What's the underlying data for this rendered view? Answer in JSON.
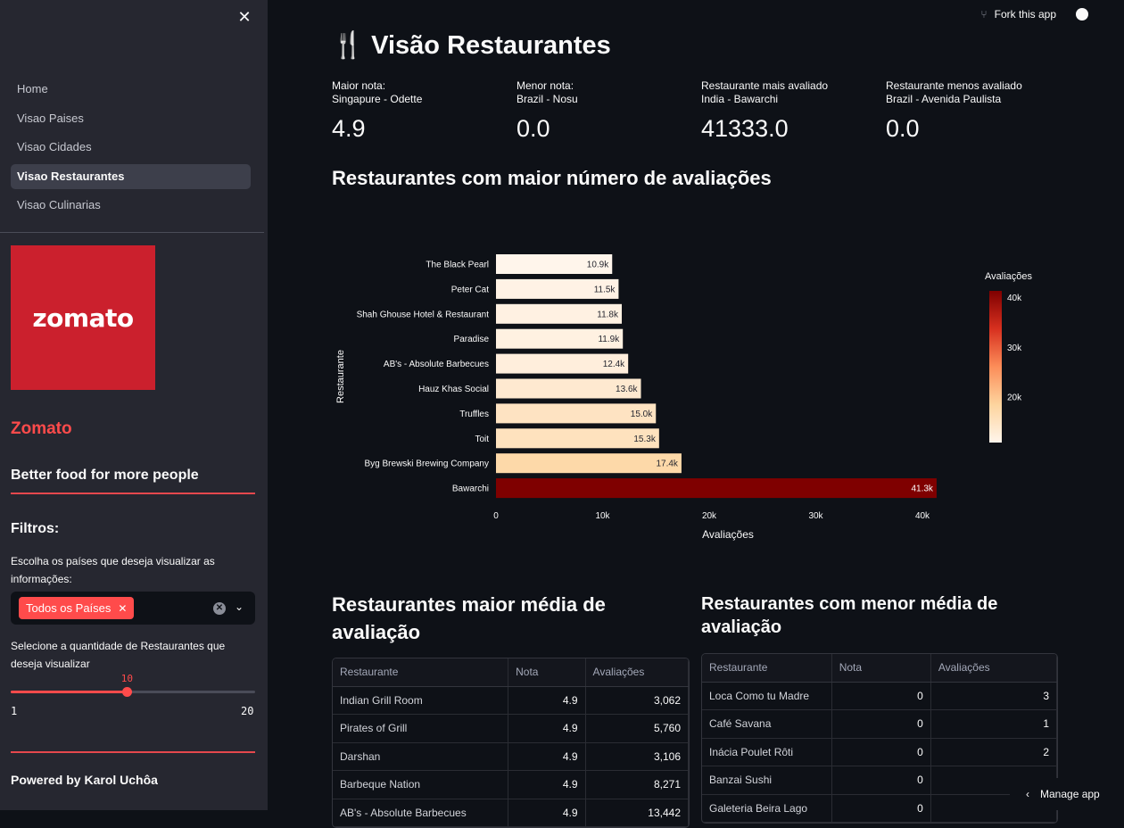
{
  "sidebar": {
    "nav": [
      "Home",
      "Visao Paises",
      "Visao Cidades",
      "Visao Restaurantes",
      "Visao Culinarias"
    ],
    "logo_text": "zomato",
    "brand": "Zomato",
    "tagline": "Better food for more people",
    "filters_title": "Filtros:",
    "countries_label": "Escolha os países que deseja visualizar as informações:",
    "countries_selected": "Todos os Países",
    "qty_label": "Selecione a quantidade de Restaurantes que deseja visualizar",
    "slider": {
      "value": 10,
      "min": 1,
      "max": 20
    },
    "powered_by": "Powered by Karol Uchôa"
  },
  "topbar": {
    "fork_label": "Fork this app"
  },
  "page": {
    "title": "🍴 Visão Restaurantes"
  },
  "metrics": [
    {
      "label1": "Maior nota:",
      "label2": "Singapure - Odette",
      "value": "4.9"
    },
    {
      "label1": "Menor nota:",
      "label2": "Brazil - Nosu",
      "value": "0.0"
    },
    {
      "label1": "Restaurante mais avaliado",
      "label2": "India - Bawarchi",
      "value": "41333.0"
    },
    {
      "label1": "Restaurante menos avaliado",
      "label2": "Brazil - Avenida Paulista",
      "value": "0.0"
    }
  ],
  "chart_heading": "Restaurantes com maior número de avaliações",
  "chart_data": {
    "type": "bar",
    "orientation": "horizontal",
    "categories": [
      "The Black Pearl",
      "Peter Cat",
      "Shah Ghouse Hotel & Restaurant",
      "Paradise",
      "AB's - Absolute Barbecues",
      "Hauz Khas Social",
      "Truffles",
      "Toit",
      "Byg Brewski Brewing Company",
      "Bawarchi"
    ],
    "values": [
      10900,
      11500,
      11800,
      11900,
      12400,
      13600,
      15000,
      15300,
      17400,
      41333
    ],
    "data_labels": [
      "10.9k",
      "11.5k",
      "11.8k",
      "11.9k",
      "12.4k",
      "13.6k",
      "15.0k",
      "15.3k",
      "17.4k",
      "41.3k"
    ],
    "xlabel": "Avaliações",
    "ylabel": "Restaurante",
    "xticks": [
      "0",
      "10k",
      "20k",
      "30k",
      "40k"
    ],
    "xlim": [
      0,
      41333
    ],
    "colorbar": {
      "title": "Avaliações",
      "ticks": [
        "40k",
        "30k",
        "20k"
      ],
      "range": [
        10900,
        41333
      ],
      "colors": [
        "#fff5eb",
        "#fdd49e",
        "#fc8d59",
        "#d7301f",
        "#7f0000"
      ]
    }
  },
  "table_best": {
    "heading": "Restaurantes maior média de avaliação",
    "columns": [
      "Restaurante",
      "Nota",
      "Avaliações"
    ],
    "rows": [
      [
        "Indian Grill Room",
        "4.9",
        "3,062"
      ],
      [
        "Pirates of Grill",
        "4.9",
        "5,760"
      ],
      [
        "Darshan",
        "4.9",
        "3,106"
      ],
      [
        "Barbeque Nation",
        "4.9",
        "8,271"
      ],
      [
        "AB's - Absolute Barbecues",
        "4.9",
        "13,442"
      ]
    ]
  },
  "table_worst": {
    "heading": "Restaurantes com menor média de avaliação",
    "columns": [
      "Restaurante",
      "Nota",
      "Avaliações"
    ],
    "rows": [
      [
        "Loca Como tu Madre",
        "0",
        "3"
      ],
      [
        "Café Savana",
        "0",
        "1"
      ],
      [
        "Inácia Poulet Rôti",
        "0",
        "2"
      ],
      [
        "Banzai Sushi",
        "0",
        ""
      ],
      [
        "Galeteria Beira Lago",
        "0",
        ""
      ]
    ]
  },
  "manage_app": "Manage app"
}
